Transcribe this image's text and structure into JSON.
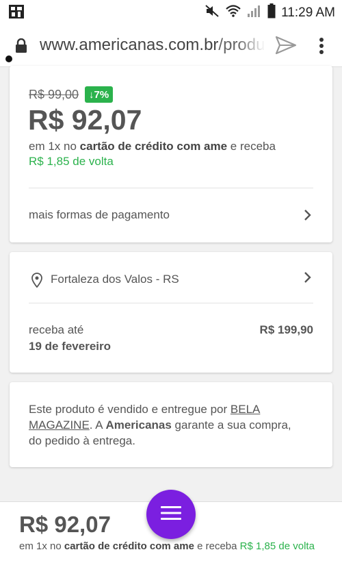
{
  "status_bar": {
    "time": "11:29 AM",
    "icons": [
      "app-notification-icon",
      "mute-icon",
      "wifi-icon",
      "signal-icon",
      "battery-icon"
    ]
  },
  "browser": {
    "url_domain": "www.americanas.com.br",
    "url_path": "/produto",
    "icons": [
      "lock-icon",
      "send-icon",
      "more-vert-icon"
    ]
  },
  "price_card": {
    "old_price": "R$ 99,00",
    "discount": "7%",
    "price": "R$ 92,07",
    "installment_prefix": "em 1x no ",
    "installment_bold": "cartão de crédito com ame",
    "installment_suffix": " e receba",
    "cashback": "R$ 1,85 de volta",
    "more_payment": "mais formas de pagamento"
  },
  "shipping_card": {
    "city": "Fortaleza dos Valos - RS",
    "receive_label": "receba até",
    "receive_date": "19 de fevereiro",
    "shipping_price": "R$ 199,90"
  },
  "seller_card": {
    "text_1": "Este produto é vendido e entregue por ",
    "seller_name": "BELA MAGAZINE",
    "text_2": ". A ",
    "brand": "Americanas",
    "text_3": " garante a sua compra, do pedido à entrega."
  },
  "bottom_bar": {
    "price": "R$ 92,07",
    "installment_prefix": "em 1x no ",
    "installment_bold": "cartão de crédito com ame",
    "installment_mid": " e receba ",
    "cashback": "R$ 1,85 de volta"
  },
  "colors": {
    "accent_purple": "#7b1fe0",
    "cashback_green": "#2bb24c"
  }
}
